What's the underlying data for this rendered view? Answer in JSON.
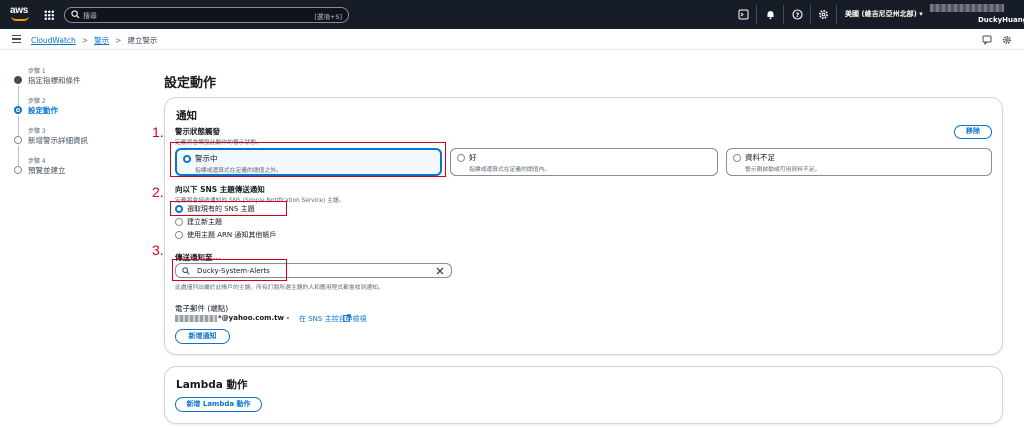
{
  "topnav": {
    "search_placeholder": "搜尋",
    "search_shortcut": "[選項+S]",
    "region": "美國 (維吉尼亞州北部) ▾",
    "account_name": "DuckyHuang"
  },
  "breadcrumb": {
    "items": [
      "CloudWatch",
      "警示",
      "建立警示"
    ]
  },
  "steps": [
    {
      "label": "步驟 1",
      "title": "指定指標和條件"
    },
    {
      "label": "步驟 2",
      "title": "設定動作"
    },
    {
      "label": "步驟 3",
      "title": "新增警示詳細資訊"
    },
    {
      "label": "步驟 4",
      "title": "預覽並建立"
    }
  ],
  "page_title": "設定動作",
  "notification": {
    "header": "通知",
    "trigger_label": "警示狀態觸發",
    "trigger_desc": "定義將會觸發此動作的警示狀態。",
    "remove_label": "移除",
    "states": [
      {
        "title": "警示中",
        "desc": "指標或運算式在定義的閾值之外。"
      },
      {
        "title": "好",
        "desc": "指標或運算式在定義的閾值內。"
      },
      {
        "title": "資料不足",
        "desc": "警示剛啟動或可用資料不足。"
      }
    ],
    "sns_label": "向以下 SNS 主題傳送通知",
    "sns_desc": "定義將會接收通知的 SNS (Simple Notification Service) 主題。",
    "sns_options": [
      "選取現有的 SNS 主題",
      "建立新主題",
      "使用主題 ARN 通知其他帳戶"
    ],
    "send_to_label": "傳送通知至...",
    "topic_value": "Ducky-System-Alerts",
    "topic_desc": "此處僅列出屬於此帳戶的主題。所有訂閱所選主題的人和應用程式都會收到通知。",
    "email_label": "電子郵件 (端點)",
    "email_value": "*@yahoo.com.tw -",
    "email_link": "在 SNS 主控台中檢視",
    "add_notification": "新增通知"
  },
  "lambda": {
    "header": "Lambda 動作",
    "add_lambda": "新增 Lambda 動作"
  },
  "annotations": [
    "1.",
    "2.",
    "3."
  ],
  "colors": {
    "accent": "#0972d3",
    "annotation": "#d0021b",
    "nav_bg": "#161d26"
  }
}
